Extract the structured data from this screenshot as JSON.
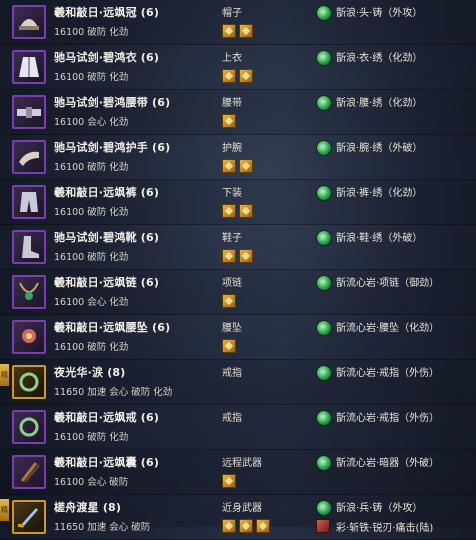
{
  "rows": [
    {
      "name": "羲和敲日·远飒冠 (6)",
      "stats": "16100 破防 化劲",
      "slot": "帽子",
      "gems": 2,
      "forge": "斮浪·头·铸（外攻）",
      "icon": "hat-icon",
      "quality": "purple"
    },
    {
      "name": "驰马试剑·碧鸿衣 (6)",
      "stats": "16100 破防 化劲",
      "slot": "上衣",
      "gems": 2,
      "forge": "斮浪·衣·绣（化劲）",
      "icon": "robe-icon",
      "quality": "purple"
    },
    {
      "name": "驰马试剑·碧鸿腰带 (6)",
      "stats": "16100 会心 化劲",
      "slot": "腰带",
      "gems": 1,
      "forge": "斮浪·腰·绣（化劲）",
      "icon": "belt-icon",
      "quality": "purple"
    },
    {
      "name": "驰马试剑·碧鸿护手 (6)",
      "stats": "16100 破防 化劲",
      "slot": "护腕",
      "gems": 2,
      "forge": "斮浪·腕·绣（外破）",
      "icon": "bracer-icon",
      "quality": "purple"
    },
    {
      "name": "羲和敲日·远飒裤 (6)",
      "stats": "16100 破防 化劲",
      "slot": "下装",
      "gems": 2,
      "forge": "斮浪·裤·绣（化劲）",
      "icon": "pants-icon",
      "quality": "purple"
    },
    {
      "name": "驰马试剑·碧鸿靴 (6)",
      "stats": "16100 破防 化劲",
      "slot": "鞋子",
      "gems": 2,
      "forge": "斮浪·鞋·绣（外破）",
      "icon": "boots-icon",
      "quality": "purple"
    },
    {
      "name": "羲和敲日·远飒链 (6)",
      "stats": "16100 会心 化劲",
      "slot": "项链",
      "gems": 1,
      "forge": "斮流心岩·项链（御劲）",
      "icon": "necklace-icon",
      "quality": "purple"
    },
    {
      "name": "羲和敲日·远飒腰坠 (6)",
      "stats": "16100 破防 化劲",
      "slot": "腰坠",
      "gems": 1,
      "forge": "斮流心岩·腰坠（化劲）",
      "icon": "pendant-icon",
      "quality": "purple"
    },
    {
      "name": "夜光华·涙 (8)",
      "stats": "11650 加速 会心 破防 化劲",
      "slot": "戒指",
      "gems": 0,
      "forge": "斮流心岩·戒指（外伤）",
      "icon": "ring-icon",
      "quality": "gold",
      "flag": "精"
    },
    {
      "name": "羲和敲日·远飒戒 (6)",
      "stats": "16100 破防 化劲",
      "slot": "戒指",
      "gems": 0,
      "forge": "斮流心岩·戒指（外伤）",
      "icon": "ring-icon",
      "quality": "purple"
    },
    {
      "name": "羲和敲日·远飒囊 (6)",
      "stats": "16100 会心 破防",
      "slot": "远程武器",
      "gems": 1,
      "forge": "斮流心岩·暗器（外破）",
      "icon": "quiver-icon",
      "quality": "purple"
    },
    {
      "name": "槎舟渡星 (8)",
      "stats": "11650 加速 会心 破防",
      "slot": "近身武器",
      "gems": 3,
      "forge": "斮浪·兵·铸（外攻）",
      "icon": "blade-icon",
      "quality": "gold",
      "flag": "精",
      "enchant": "彩·斩铁·锐刃·痛击(陆)"
    }
  ]
}
